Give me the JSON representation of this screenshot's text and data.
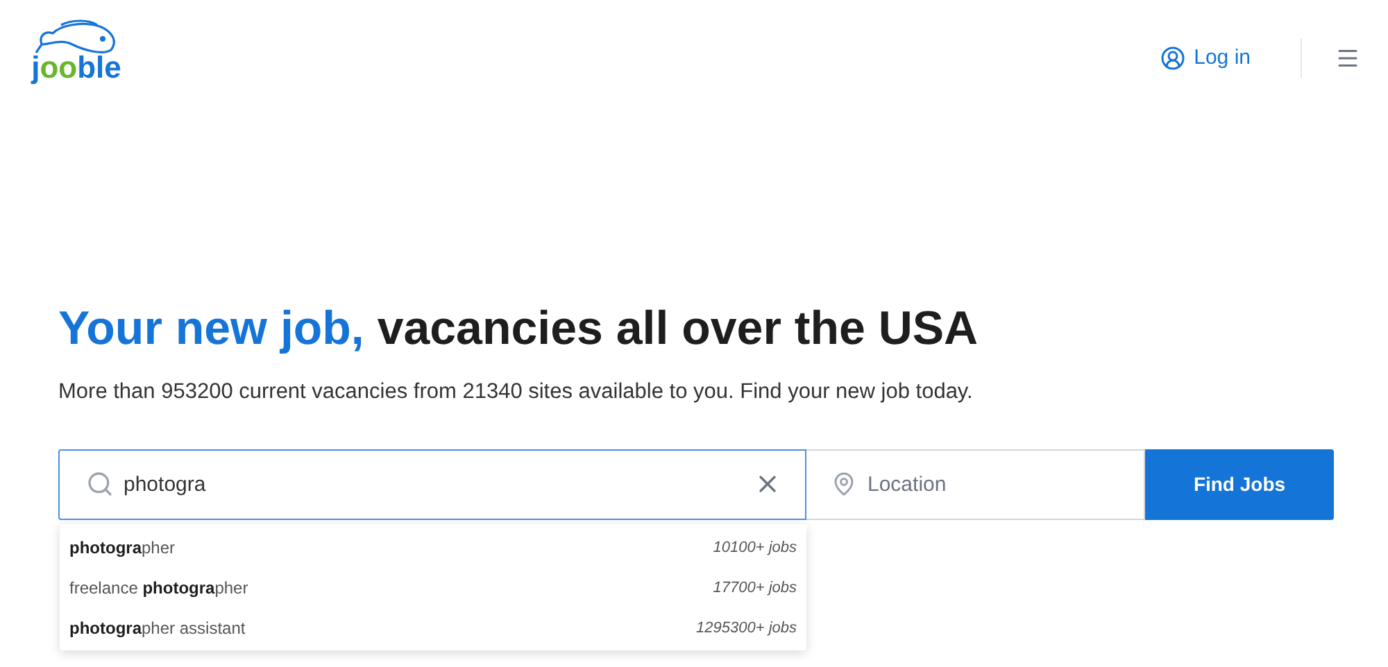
{
  "logo": {
    "parts": [
      {
        "text": "j",
        "color": "#1574d8"
      },
      {
        "text": "oo",
        "color": "#69b62d"
      },
      {
        "text": "ble",
        "color": "#1574d8"
      }
    ]
  },
  "header": {
    "login": "Log in"
  },
  "hero": {
    "title_highlight": "Your new job,",
    "title_rest": "vacancies all over the USA",
    "subtitle": "More than 953200 current vacancies from 21340 sites available to you. Find your new job today."
  },
  "search": {
    "value": "photogra",
    "location_placeholder": "Location",
    "button": "Find Jobs"
  },
  "suggestions": [
    {
      "text": "**photogra**pher",
      "count": "10100+ jobs"
    },
    {
      "text": "freelance **photogra**pher",
      "count": "17700+ jobs"
    },
    {
      "text": "**photogra**pher assistant",
      "count": "1295300+ jobs"
    }
  ]
}
